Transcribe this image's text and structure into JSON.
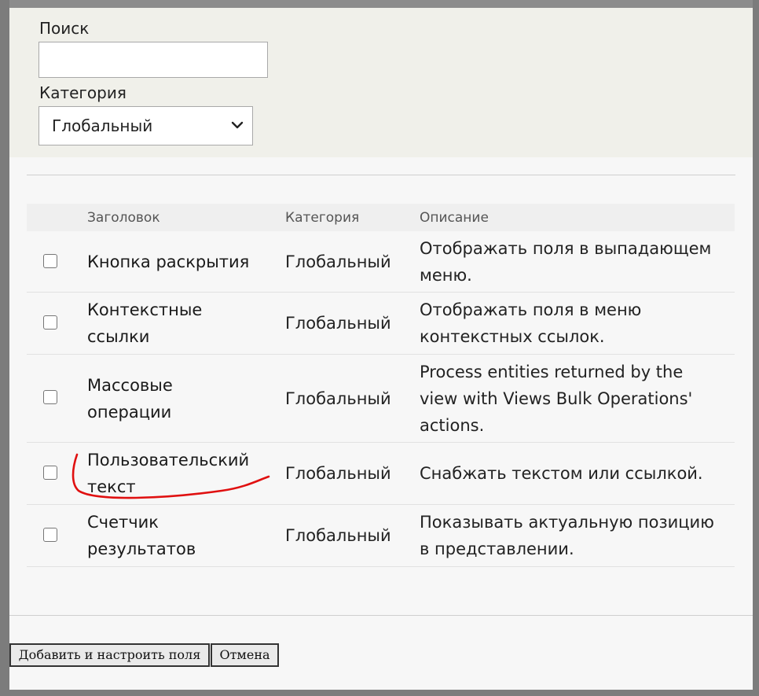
{
  "filters": {
    "search_label": "Поиск",
    "search_value": "",
    "category_label": "Категория",
    "category_selected": "Глобальный"
  },
  "table": {
    "headers": {
      "title": "Заголовок",
      "category": "Категория",
      "description": "Описание"
    },
    "rows": [
      {
        "title_lines": [
          "Кнопка раскрытия"
        ],
        "category": "Глобальный",
        "description_lines": [
          "Отображать поля в выпадающем",
          "меню."
        ]
      },
      {
        "title_lines": [
          "Контекстные",
          "ссылки"
        ],
        "category": "Глобальный",
        "description_lines": [
          "Отображать поля в меню",
          "контекстных ссылок."
        ]
      },
      {
        "title_lines": [
          "Массовые",
          "операции"
        ],
        "category": "Глобальный",
        "description_lines": [
          "Process entities returned by the",
          "view with Views Bulk Operations'",
          "actions."
        ]
      },
      {
        "title_lines": [
          "Пользовательский",
          "текст"
        ],
        "category": "Глобальный",
        "description_lines": [
          "Снабжать текстом или ссылкой."
        ]
      },
      {
        "title_lines": [
          "Счетчик",
          "результатов"
        ],
        "category": "Глобальный",
        "description_lines": [
          "Показывать актуальную позицию",
          "в представлении."
        ]
      }
    ]
  },
  "buttons": {
    "add_label": "Добавить и настроить поля",
    "cancel_label": "Отмена"
  },
  "colors": {
    "annotation": "#e01010"
  }
}
